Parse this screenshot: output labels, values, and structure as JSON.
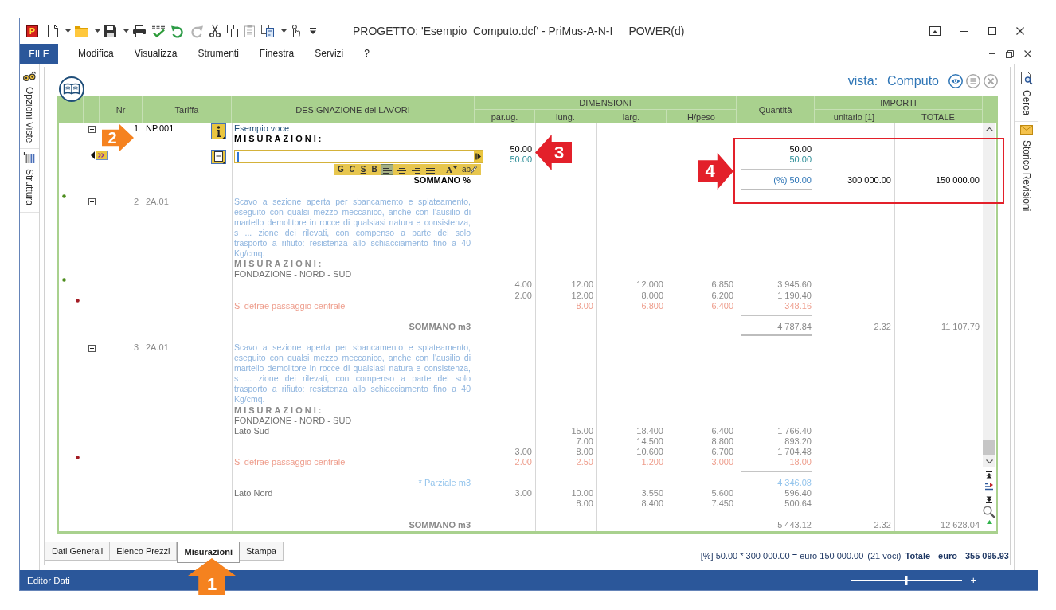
{
  "title_bar": {
    "logo": "P",
    "title": "PROGETTO: 'Esempio_Computo.dcf' - PriMus-A-N-I",
    "edition": "POWER(d)"
  },
  "menu_bar": {
    "file": "FILE",
    "items": [
      "Modifica",
      "Visualizza",
      "Strumenti",
      "Finestra",
      "Servizi",
      "?"
    ]
  },
  "side_left": [
    {
      "label": "Opzioni Viste"
    },
    {
      "label": "Struttura"
    }
  ],
  "side_right": [
    {
      "label": "Cerca"
    },
    {
      "label": "Storico Revisioni"
    }
  ],
  "view": {
    "label": "vista:",
    "value": "Computo",
    "buttons": [
      {
        "disabled": false
      },
      {
        "disabled": true
      },
      {
        "disabled": true
      }
    ]
  },
  "table": {
    "columns": [
      {
        "label": "Nr"
      },
      {
        "label": "Tariffa"
      },
      {
        "label": "DESIGNAZIONE dei LAVORI"
      },
      {
        "label": "DIMENSIONI",
        "children": [
          {
            "label": "par.ug."
          },
          {
            "label": "lung."
          },
          {
            "label": "larg."
          },
          {
            "label": "H/peso"
          }
        ]
      },
      {
        "label": "Quantità"
      },
      {
        "label": "IMPORTI",
        "children": [
          {
            "label": "unitario [1]"
          },
          {
            "label": "TOTALE"
          }
        ]
      }
    ],
    "items": [
      {
        "nr": "1",
        "tariffa": "NP.001",
        "active": true,
        "expanded": true,
        "rows": [
          {
            "kind": "title",
            "text": "Esempio voce"
          },
          {
            "kind": "heading",
            "text": "MISURAZIONI:"
          },
          {
            "kind": "edit",
            "values": [
              {
                "kind": "measure",
                "par_ug": "50.00",
                "quantita": "50.00"
              },
              {
                "kind": "result",
                "par_ug": "50.00",
                "quantita": "50.00"
              }
            ],
            "format_toolbar": [
              {
                "kind": "bold",
                "label": "G"
              },
              {
                "kind": "italic",
                "label": "C"
              },
              {
                "kind": "underline",
                "label": "S"
              },
              {
                "kind": "strike",
                "label": "B"
              },
              {
                "kind": "align-left",
                "selected": true
              },
              {
                "kind": "align-center",
                "selected": false
              },
              {
                "kind": "align-right",
                "selected": false
              },
              {
                "kind": "justify",
                "selected": false
              },
              {
                "kind": "font-color",
                "label": "A"
              },
              {
                "kind": "highlight",
                "label": "ab"
              }
            ]
          },
          {
            "kind": "sum",
            "text": "SOMMANO %",
            "quantita": "(%) 50.00",
            "unitario": "300 000.00",
            "totale": "150 000.00"
          }
        ]
      },
      {
        "nr": "2",
        "tariffa": "2A.01",
        "active": false,
        "expanded": true,
        "rows": [
          {
            "kind": "description",
            "marker": {
              "kind": "item",
              "color": "#4c8c1c"
            },
            "lines": [
              "Scavo a sezione aperta per sbancamento e splateamento,",
              "eseguito con qualsi mezzo meccanico, anche con l'ausilio di",
              "martello demolitore in rocce di qualsiasi natura e consistenza,",
              "s ... zione dei rilevati, con compenso a parte del solo",
              "trasporto a rifiuto: resistenza allo schiacciamento fino a 40",
              "Kg/cmq."
            ]
          },
          {
            "kind": "heading",
            "text": "MISURAZIONI:"
          },
          {
            "kind": "group",
            "text": "FONDAZIONE - NORD - SUD"
          },
          {
            "kind": "measure",
            "marker": {
              "kind": "item",
              "color": "#4c8c1c"
            },
            "par_ug": "4.00",
            "lung": "12.00",
            "larg": "12.000",
            "h_peso": "6.850",
            "quantita": "3 945.60"
          },
          {
            "kind": "measure",
            "par_ug": "2.00",
            "lung": "12.00",
            "larg": "8.000",
            "h_peso": "6.200",
            "quantita": "1 190.40"
          },
          {
            "kind": "deduction",
            "marker": {
              "kind": "line",
              "color": "#a31c24"
            },
            "text": "Si detrae passaggio centrale",
            "lung": "8.00",
            "larg": "6.800",
            "h_peso": "6.400",
            "quantita": "-348.16"
          },
          {
            "kind": "sum",
            "text": "SOMMANO m3",
            "quantita": "4 787.84",
            "unitario": "2.32",
            "totale": "11 107.79"
          }
        ]
      },
      {
        "nr": "3",
        "tariffa": "2A.01",
        "active": false,
        "expanded": true,
        "rows": [
          {
            "kind": "description",
            "lines": [
              "Scavo a sezione aperta per sbancamento e splateamento,",
              "eseguito con qualsi mezzo meccanico, anche con l'ausilio di",
              "martello demolitore in rocce di qualsiasi natura e consistenza,",
              "s ... zione dei rilevati, con compenso a parte del solo",
              "trasporto a rifiuto: resistenza allo schiacciamento fino a 40",
              "Kg/cmq."
            ]
          },
          {
            "kind": "heading",
            "text": "MISURAZIONI:"
          },
          {
            "kind": "group",
            "text": "FONDAZIONE - NORD - SUD"
          },
          {
            "kind": "measure",
            "text": "Lato Sud",
            "lung": "15.00",
            "larg": "18.400",
            "h_peso": "6.400",
            "quantita": "1 766.40"
          },
          {
            "kind": "measure",
            "lung": "7.00",
            "larg": "14.500",
            "h_peso": "8.800",
            "quantita": "893.20"
          },
          {
            "kind": "measure",
            "par_ug": "3.00",
            "lung": "8.00",
            "larg": "10.600",
            "h_peso": "6.700",
            "quantita": "1 704.48"
          },
          {
            "kind": "deduction",
            "marker": {
              "kind": "line",
              "color": "#a31c24"
            },
            "text": "Si detrae passaggio centrale",
            "par_ug": "2.00",
            "lung": "2.50",
            "larg": "1.200",
            "h_peso": "3.000",
            "quantita": "-18.00"
          },
          {
            "kind": "partial",
            "text": "* Parziale m3",
            "quantita": "4 346.08"
          },
          {
            "kind": "measure",
            "text": "Lato Nord",
            "par_ug": "3.00",
            "lung": "10.00",
            "larg": "3.550",
            "h_peso": "5.600",
            "quantita": "596.40"
          },
          {
            "kind": "measure",
            "lung": "8.00",
            "larg": "8.400",
            "h_peso": "7.450",
            "quantita": "500.64"
          },
          {
            "kind": "sum",
            "text": "SOMMANO m3",
            "quantita": "5 443.12",
            "unitario": "2.32",
            "totale": "12 628.04"
          }
        ]
      }
    ]
  },
  "bottom_tabs": [
    {
      "label": "Dati Generali",
      "selected": false
    },
    {
      "label": "Elenco Prezzi",
      "selected": false
    },
    {
      "label": "Misurazioni",
      "selected": true
    },
    {
      "label": "Stampa",
      "selected": false
    }
  ],
  "summary": {
    "formula": "[%] 50.00 * 300 000.00 = euro 150 000.00",
    "count": "(21 voci)",
    "total_label": "Totale",
    "currency": "euro",
    "total": "355 095.93"
  },
  "status_bar": {
    "text": "Editor Dati",
    "zoom": {
      "minus": "–",
      "plus": "+",
      "level": 0.5
    }
  },
  "annotations": [
    {
      "kind": "arrow-up",
      "number": "1",
      "color": "#f5821f"
    },
    {
      "kind": "arrow-right",
      "number": "2",
      "color": "#f5821f"
    },
    {
      "kind": "arrow-left",
      "number": "3",
      "color": "#e3202a"
    },
    {
      "kind": "arrow-right",
      "number": "4",
      "color": "#e3202a"
    },
    {
      "kind": "frame",
      "color": "#e3202a"
    }
  ]
}
